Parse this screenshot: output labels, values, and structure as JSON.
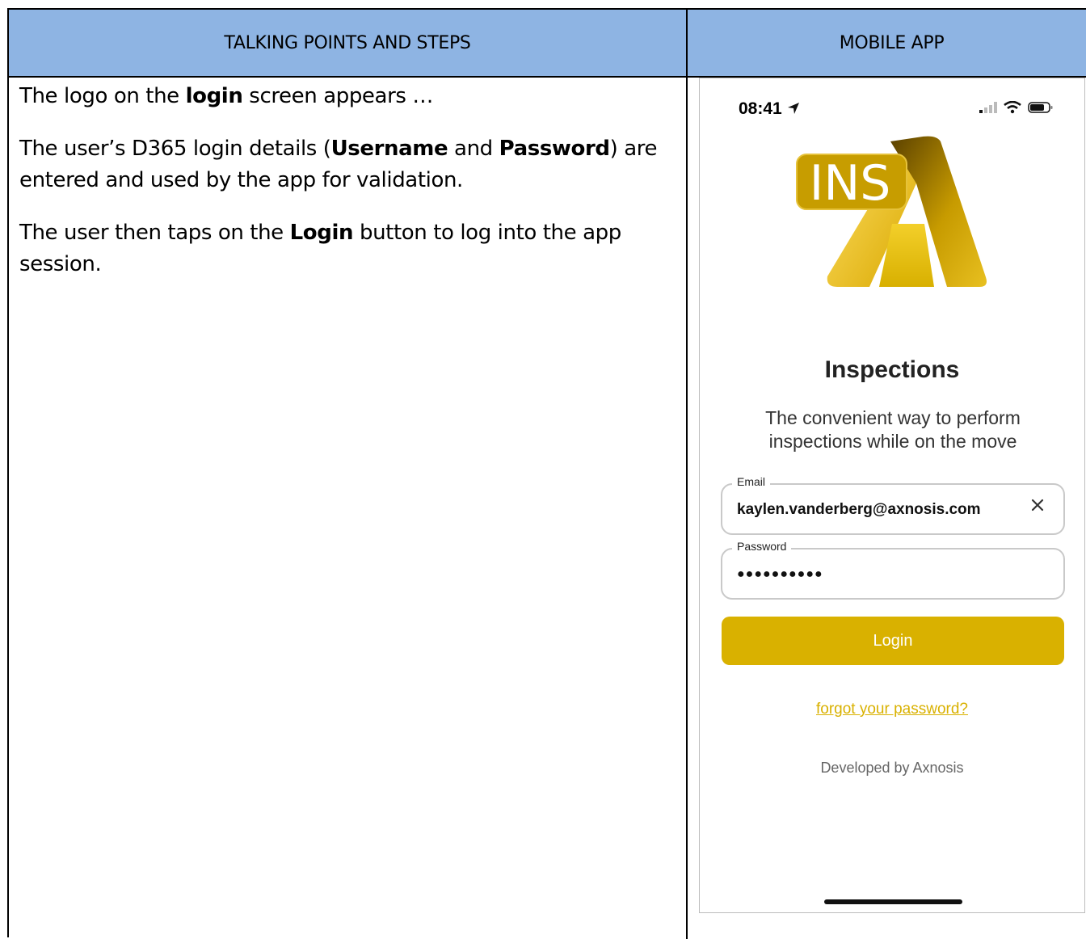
{
  "table": {
    "header_left": "TALKING POINTS AND STEPS",
    "header_right": "MOBILE APP"
  },
  "steps": {
    "p1_pre": "The logo on the ",
    "p1_bold": "login",
    "p1_post": " screen appears …",
    "p2_pre": "The user’s D365 login details (",
    "p2_bold1": "Username",
    "p2_mid": " and ",
    "p2_bold2": "Password",
    "p2_post": ") are entered and used by the app for validation.",
    "p3_pre": "The user then taps on the ",
    "p3_bold": "Login",
    "p3_post": " button to log into the app session."
  },
  "phone": {
    "status_time": "08:41",
    "logo_text": "INS",
    "app_title": "Inspections",
    "tagline": "The convenient way to perform inspections while on the move",
    "email": {
      "label": "Email",
      "value": "kaylen.vanderberg@axnosis.com"
    },
    "password": {
      "label": "Password",
      "value": "●●●●●●●●●●"
    },
    "login_label": "Login",
    "forgot_label": "forgot your password?",
    "developed_by": "Developed by Axnosis"
  },
  "colors": {
    "header_bg": "#8eb4e3",
    "accent": "#d9b100"
  }
}
